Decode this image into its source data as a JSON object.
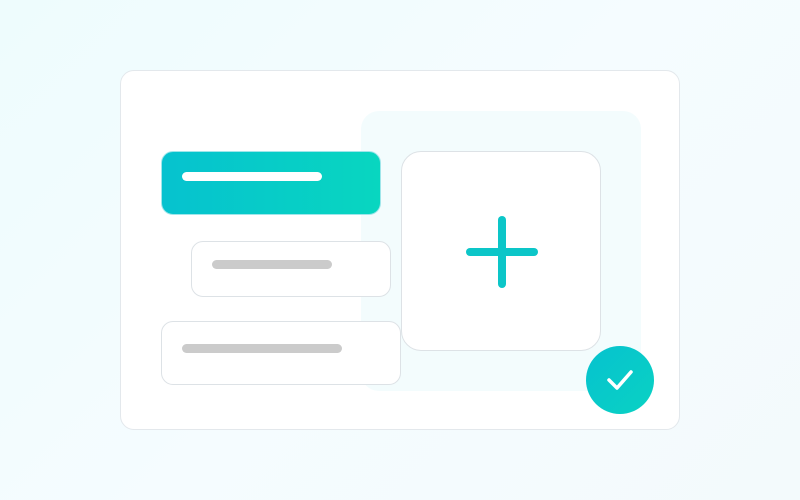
{
  "theme": {
    "accent": "#06c2cf",
    "accent_secondary": "#08d6c0",
    "placeholder_bar": "#cbcbcb",
    "border": "#dde2e6",
    "background": "#eefcfd"
  },
  "list": {
    "items": [
      {
        "state": "selected",
        "icon": "none"
      },
      {
        "state": "default",
        "icon": "none"
      },
      {
        "state": "default",
        "icon": "none"
      }
    ]
  },
  "add_tile": {
    "icon": "plus-icon"
  },
  "confirm": {
    "icon": "check-icon"
  }
}
